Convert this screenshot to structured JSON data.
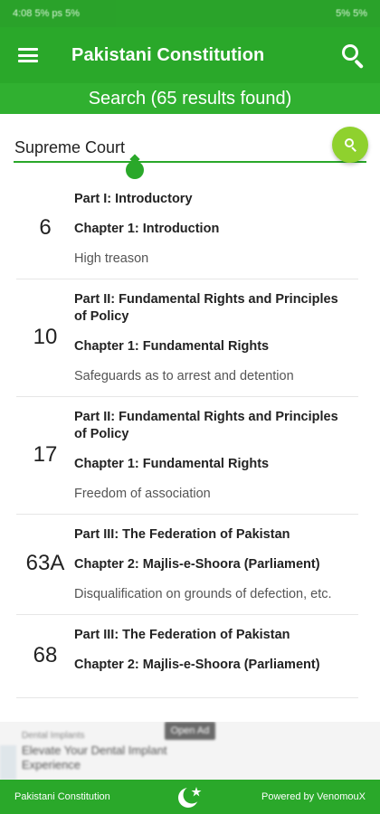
{
  "status_bar": {
    "left": "4:08  5% ps 5%",
    "right": "5% 5%"
  },
  "app_bar": {
    "title": "Pakistani Constitution",
    "menu_icon": "hamburger-menu-icon",
    "search_icon": "search-icon"
  },
  "results_banner": "Search (65 results found)",
  "search": {
    "value": "Supreme Court",
    "button_icon": "search-icon"
  },
  "results": [
    {
      "number": "6",
      "part": "Part I: Introductory",
      "chapter": "Chapter 1: Introduction",
      "title": "High treason"
    },
    {
      "number": "10",
      "part": "Part II: Fundamental Rights and Principles of Policy",
      "chapter": "Chapter 1: Fundamental Rights",
      "title": "Safeguards as to arrest and detention"
    },
    {
      "number": "17",
      "part": "Part II: Fundamental Rights and Principles of Policy",
      "chapter": "Chapter 1: Fundamental Rights",
      "title": "Freedom of association"
    },
    {
      "number": "63A",
      "part": "Part III: The Federation of Pakistan",
      "chapter": "Chapter 2: Majlis-e-Shoora (Parliament)",
      "title": "Disqualification on grounds of defection, etc."
    },
    {
      "number": "68",
      "part": "Part III: The Federation of Pakistan",
      "chapter": "Chapter 2: Majlis-e-Shoora (Parliament)",
      "title": ""
    }
  ],
  "ad": {
    "line1": "Dental Implants",
    "line2": "Elevate Your Dental Implant",
    "line3": "Experience",
    "open_label": "Open Ad"
  },
  "footer": {
    "left": "Pakistani Constitution",
    "right": "Powered by VenomouX",
    "logo_icon": "crescent-star-icon"
  },
  "colors": {
    "primary": "#2aa82a",
    "accent": "#8fd12e"
  }
}
